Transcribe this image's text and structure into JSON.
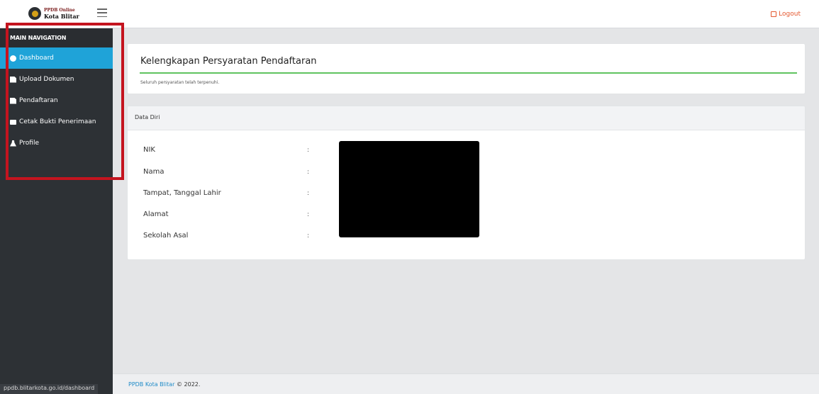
{
  "header": {
    "logo_line1": "PPDB Online",
    "logo_line2": "Kota Blitar",
    "logout_label": "Logout"
  },
  "sidebar": {
    "title": "MAIN NAVIGATION",
    "items": [
      {
        "label": "Dashboard",
        "icon": "dashboard-icon",
        "active": true
      },
      {
        "label": "Upload Dokumen",
        "icon": "file-icon",
        "active": false
      },
      {
        "label": "Pendaftaran",
        "icon": "file-icon",
        "active": false
      },
      {
        "label": "Cetak Bukti Penerimaan",
        "icon": "print-icon",
        "active": false
      },
      {
        "label": "Profile",
        "icon": "user-icon",
        "active": false
      }
    ]
  },
  "requirements_card": {
    "title": "Kelengkapan Persyaratan Pendaftaran",
    "note": "Seluruh persyaratan telah terpenuhi."
  },
  "personal_data": {
    "title": "Data Diri",
    "rows": [
      {
        "label": "NIK",
        "separator": ":"
      },
      {
        "label": "Nama",
        "separator": ":"
      },
      {
        "label": "Tampat, Tanggal Lahir",
        "separator": ":"
      },
      {
        "label": "Alamat",
        "separator": ":"
      },
      {
        "label": "Sekolah Asal",
        "separator": ":"
      }
    ]
  },
  "footer": {
    "brand": "PPDB Kota Blitar",
    "copyright": "© 2022."
  },
  "status_bar": {
    "url": "ppdb.blitarkota.go.id/dashboard"
  },
  "colors": {
    "accent": "#1fa3d8",
    "sidebar_bg": "#2d3135",
    "success_rule": "#5fc35f",
    "logout": "#e4572e",
    "highlight": "#c4141f"
  }
}
